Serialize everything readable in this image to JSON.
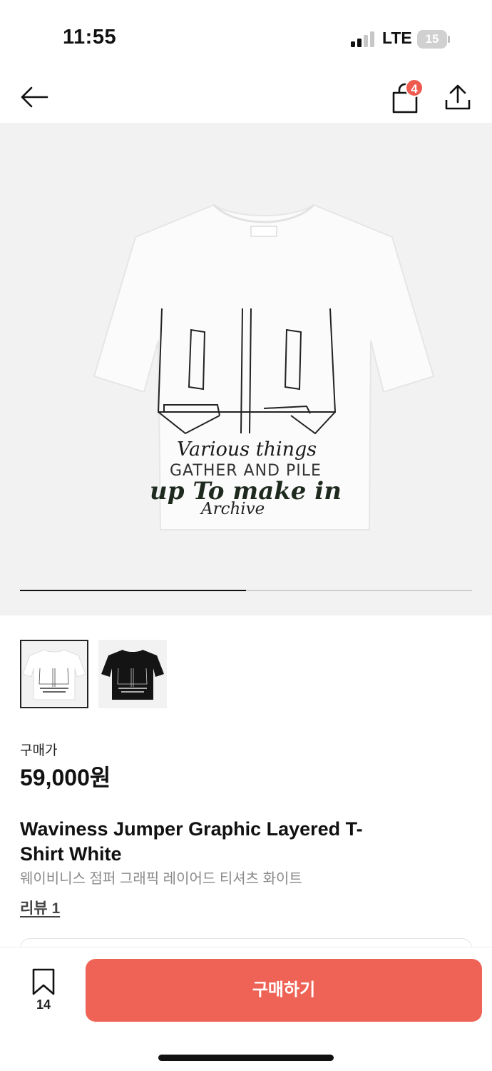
{
  "status_bar": {
    "time": "11:55",
    "network": "LTE",
    "battery": "15"
  },
  "header": {
    "back_icon": "arrow-left-icon",
    "cart_badge": "4",
    "share_icon": "share-icon"
  },
  "gallery": {
    "print_text": [
      "Various things",
      "GATHER AND PILE",
      "up To make in",
      "Archive"
    ],
    "slide_progress": 0.5,
    "thumbnails": [
      {
        "color": "White"
      },
      {
        "color": "Black"
      }
    ]
  },
  "product": {
    "price_label": "구매가",
    "price": "59,000원",
    "title_en": "Waviness Jumper Graphic Layered T-Shirt White",
    "title_ko": "웨이비니스 점퍼 그래픽 레이어드 티셔츠 화이트",
    "review_link": "리뷰 1"
  },
  "bottom_bar": {
    "save_count": "14",
    "buy_label": "구매하기"
  },
  "colors": {
    "accent": "#ef6356",
    "badge": "#ef5a4e"
  }
}
